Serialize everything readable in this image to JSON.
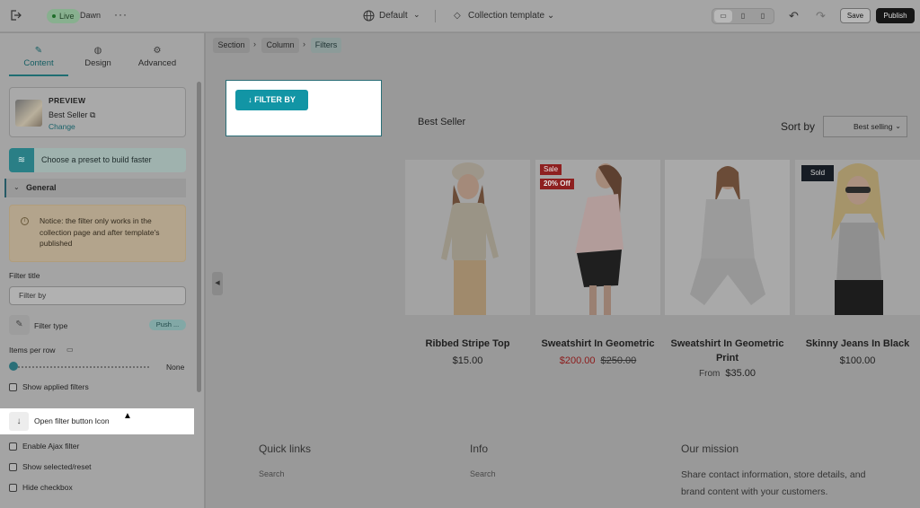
{
  "topbar": {
    "live_label": "Live",
    "theme_name": "Dawn",
    "more": "···",
    "language": "Default",
    "template": "Collection template",
    "save_label": "Save",
    "publish_label": "Publish"
  },
  "sidebar": {
    "tabs": [
      {
        "label": "Content",
        "icon": "pencil-icon"
      },
      {
        "label": "Design",
        "icon": "palette-icon"
      },
      {
        "label": "Advanced",
        "icon": "gear-icon"
      }
    ],
    "preview": {
      "title": "PREVIEW",
      "name": "Best Seller",
      "change": "Change"
    },
    "preset_label": "Choose a preset to build faster",
    "general_label": "General",
    "notice": "Notice: the filter only works in the collection page and after template's published",
    "filter_title_label": "Filter title",
    "filter_title_value": "Filter by",
    "filter_type_label": "Filter type",
    "filter_type_value": "Push ...",
    "items_per_row_label": "Items per row",
    "items_per_row_value": "None",
    "show_applied_filters": "Show applied filters",
    "open_filter_button_icon": "Open filter button Icon",
    "enable_ajax_filter": "Enable Ajax filter",
    "show_selected_reset": "Show selected/reset",
    "hide_checkbox": "Hide checkbox"
  },
  "breadcrumbs": [
    "Section",
    "Column",
    "Filters"
  ],
  "canvas": {
    "filter_button_label": "↓ FILTER BY",
    "collection_title": "Best Seller",
    "sort_label": "Sort by",
    "sort_value": "Best selling",
    "products": [
      {
        "name": "Ribbed Stripe Top",
        "price": "$15.00"
      },
      {
        "name": "Sweatshirt In Geometric",
        "sale_price": "$200.00",
        "compare_price": "$250.00",
        "badge_sale": "Sale",
        "badge_off": "20% Off"
      },
      {
        "name": "Sweatshirt In Geometric Print",
        "from_label": "From",
        "price": "$35.00"
      },
      {
        "name": "Skinny Jeans In Black",
        "price": "$100.00",
        "badge_sold": "Sold"
      }
    ],
    "footer": {
      "quick_links": {
        "heading": "Quick links",
        "link": "Search"
      },
      "info": {
        "heading": "Info",
        "link": "Search"
      },
      "mission": {
        "heading": "Our mission",
        "text": "Share contact information, store details, and brand content with your customers."
      }
    }
  },
  "colors": {
    "accent_teal": "#1295a5",
    "publish_bg": "#161616",
    "sale_red": "#8e2020"
  }
}
